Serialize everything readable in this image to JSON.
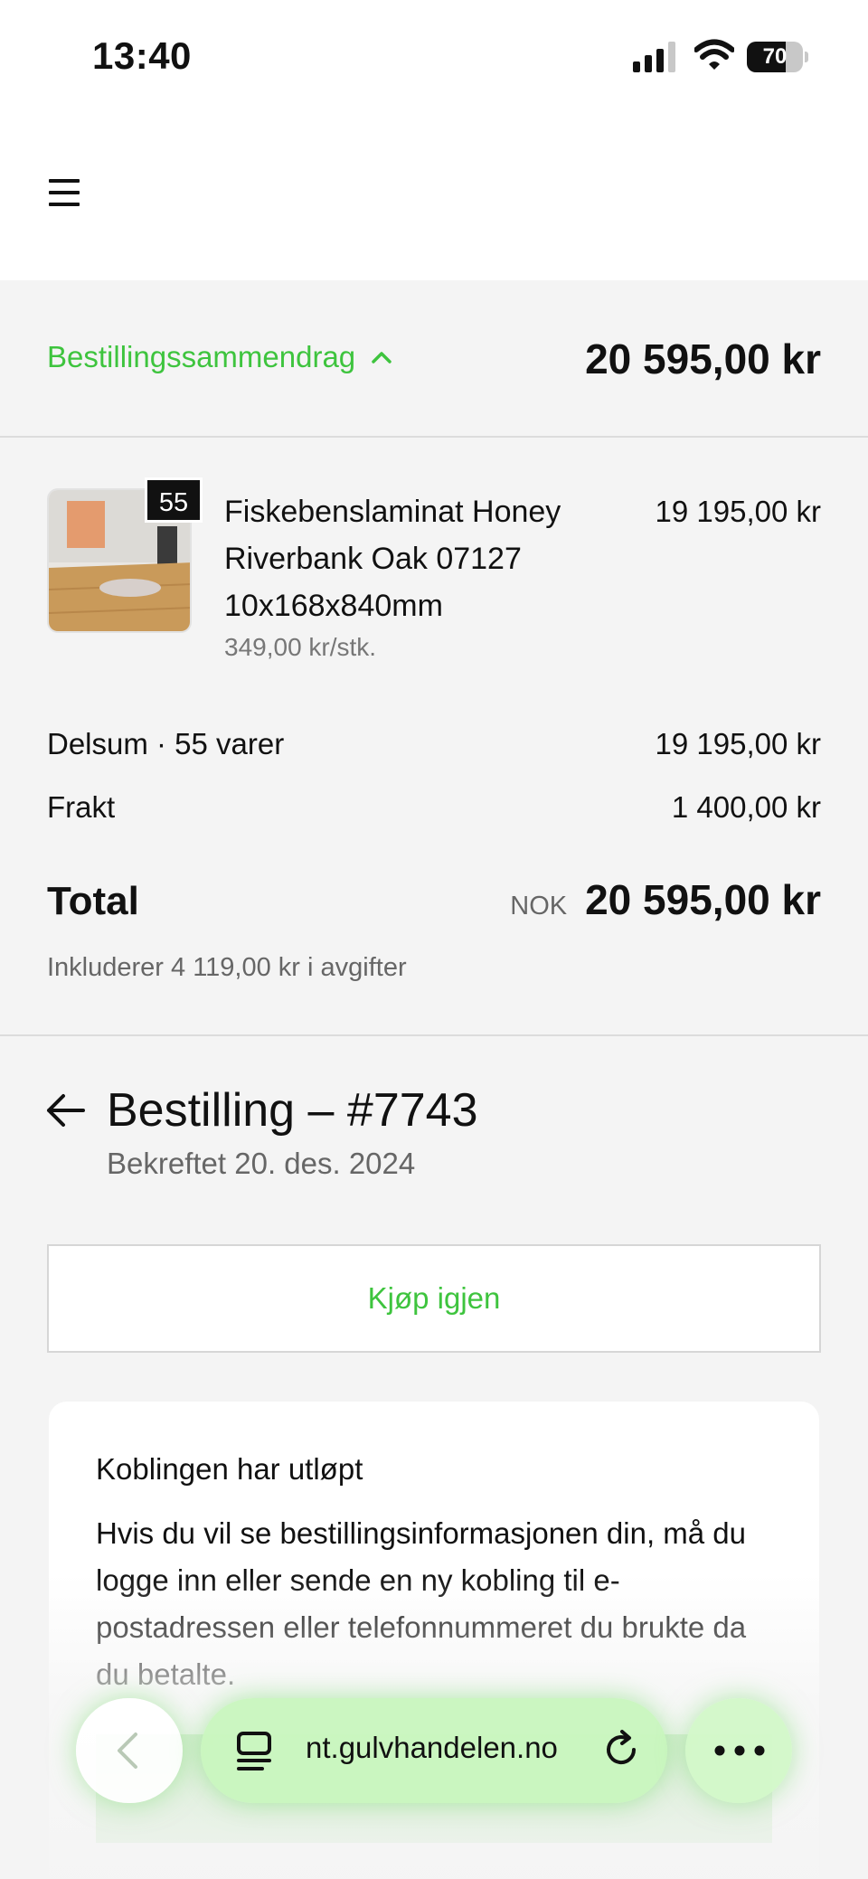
{
  "status_bar": {
    "time": "13:40",
    "battery": "70",
    "battery_level": 0.7
  },
  "summary": {
    "toggle_label": "Bestillingssammendrag",
    "total": "20 595,00 kr"
  },
  "line_item": {
    "quantity": "55",
    "name": "Fiskebenslaminat Honey Riverbank Oak 07127 10x168x840mm",
    "unit_price": "349,00 kr/stk.",
    "price": "19 195,00 kr"
  },
  "subtotal": {
    "label": "Delsum · 55 varer",
    "value": "19 195,00 kr"
  },
  "shipping": {
    "label": "Frakt",
    "value": "1 400,00 kr"
  },
  "total": {
    "label": "Total",
    "currency": "NOK",
    "value": "20 595,00 kr"
  },
  "tax_note": "Inkluderer 4 119,00 kr i avgifter",
  "order": {
    "title": "Bestilling – #7743",
    "date": "Bekreftet 20. des. 2024"
  },
  "buy_again_label": "Kjøp igjen",
  "expired_card": {
    "title": "Koblingen har utløpt",
    "text": "Hvis du vil se bestillingsinformasjonen din, må du logge inn eller sende en ny kobling til e-postadressen eller telefonnummeret du brukte da du betalte."
  },
  "browser": {
    "url": "nt.gulvhandelen.no"
  },
  "colors": {
    "accent": "#3ec43e",
    "background": "#f4f4f4"
  }
}
